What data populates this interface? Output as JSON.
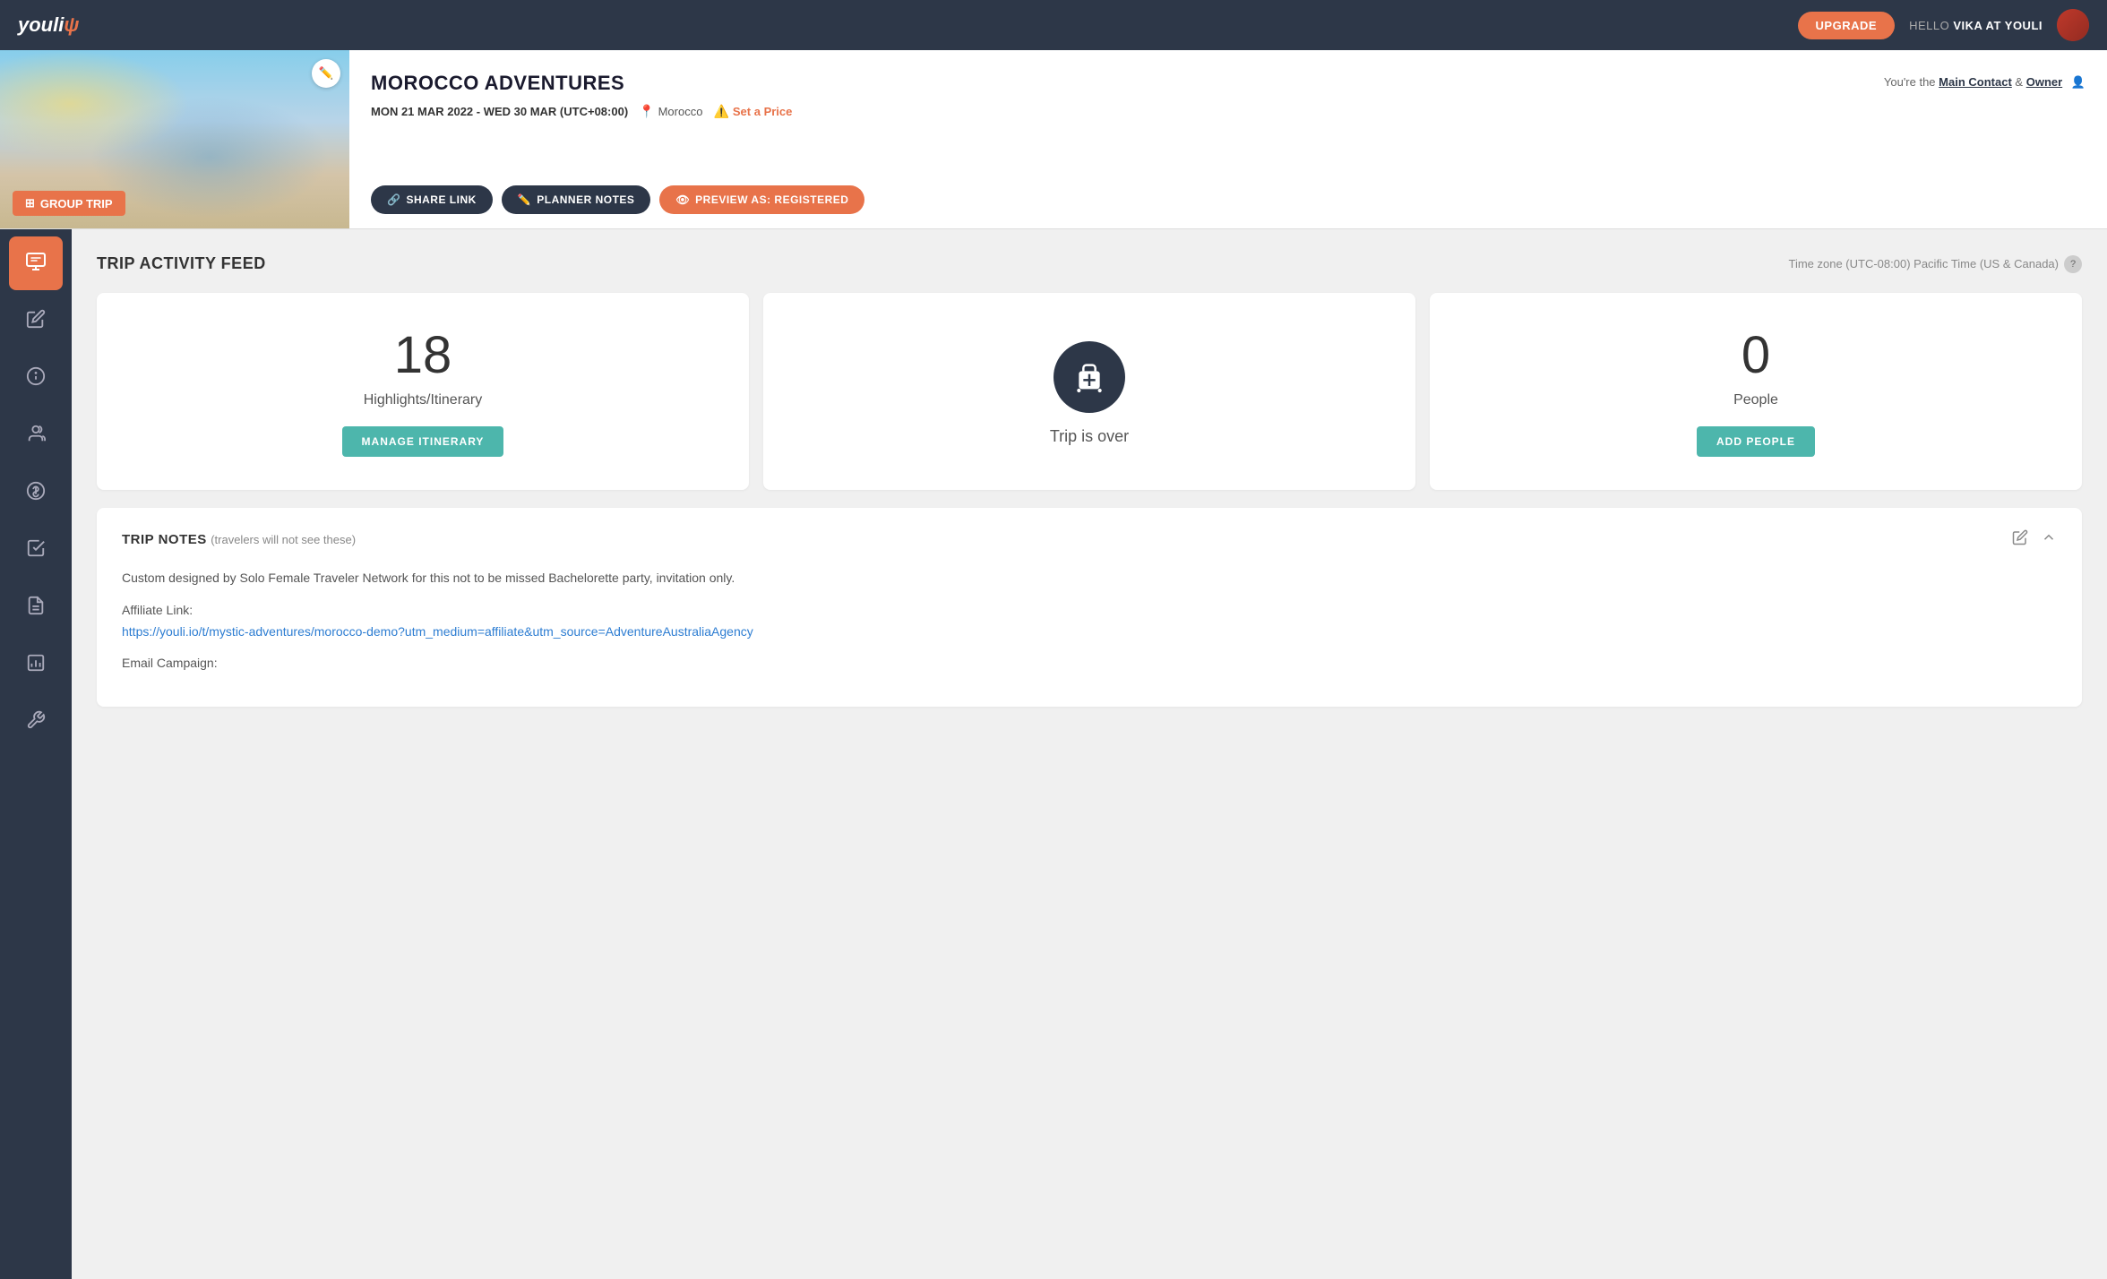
{
  "app": {
    "logo": "youli",
    "logo_mark": "ψ"
  },
  "nav": {
    "upgrade_btn": "UPGRADE",
    "hello_prefix": "HELLO",
    "hello_user": "VIKA AT YOULI"
  },
  "trip": {
    "title": "MOROCCO ADVENTURES",
    "dates": "MON 21 MAR 2022 - WED 30 MAR (UTC+08:00)",
    "location": "Morocco",
    "price_cta": "Set a Price",
    "badge": "GROUP TRIP",
    "meta_contact": "Main Contact",
    "meta_owner": "Owner",
    "meta_prefix": "You're the",
    "meta_and": "&",
    "btn_share": "SHARE LINK",
    "btn_notes": "PLANNER NOTES",
    "btn_preview": "PREVIEW AS: REGISTERED"
  },
  "sidebar": {
    "items": [
      {
        "id": "activity-feed",
        "icon": "💬",
        "active": true
      },
      {
        "id": "edit",
        "icon": "✏️",
        "active": false
      },
      {
        "id": "info",
        "icon": "ℹ️",
        "active": false
      },
      {
        "id": "people",
        "icon": "👤",
        "active": false
      },
      {
        "id": "pricing",
        "icon": "$",
        "active": false
      },
      {
        "id": "tasks",
        "icon": "✓",
        "active": false
      },
      {
        "id": "documents",
        "icon": "📄",
        "active": false
      },
      {
        "id": "reports",
        "icon": "📊",
        "active": false
      },
      {
        "id": "tools",
        "icon": "🔧",
        "active": false
      }
    ]
  },
  "main": {
    "section_title": "TRIP ACTIVITY FEED",
    "timezone": "Time zone (UTC-08:00) Pacific Time (US & Canada)"
  },
  "cards": [
    {
      "id": "itinerary",
      "number": "18",
      "label": "Highlights/Itinerary",
      "btn_label": "MANAGE ITINERARY"
    },
    {
      "id": "trip-status",
      "status_text": "Trip is over"
    },
    {
      "id": "people",
      "number": "0",
      "label": "People",
      "btn_label": "ADD PEOPLE"
    }
  ],
  "trip_notes": {
    "title": "TRIP NOTES",
    "subtitle": "(travelers will not see these)",
    "content_line1": "Custom designed by Solo Female Traveler Network for this not to be missed Bachelorette party, invitation only.",
    "affiliate_label": "Affiliate Link:",
    "affiliate_url": "https://youli.io/t/mystic-adventures/morocco-demo?utm_medium=affiliate&utm_source=AdventureAustraliaAgency",
    "email_label": "Email Campaign:"
  }
}
